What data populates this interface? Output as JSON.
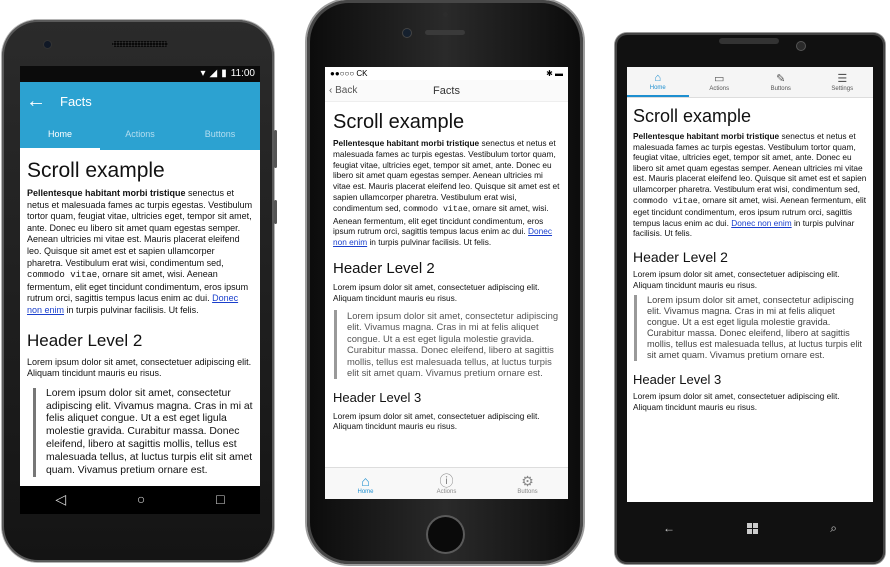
{
  "content": {
    "title": "Scroll example",
    "para_bold": "Pellentesque habitant morbi tristique",
    "para_part1": " senectus et netus et malesuada fames ac turpis egestas. Vestibulum tortor quam, feugiat vitae, ultricies eget, tempor sit amet, ante. Donec eu libero sit amet quam egestas semper. Aenean ultricies mi vitae est. Mauris placerat eleifend leo. Quisque sit amet est et sapien ullamcorper pharetra. Vestibulum erat wisi, condimentum sed, ",
    "para_code": "commodo vitae",
    "para_part2": ", ornare sit amet, wisi. Aenean fermentum, elit eget tincidunt condimentum, eros ipsum rutrum orci, sagittis tempus lacus enim ac dui. ",
    "para_link": "Donec non enim",
    "para_part3": " in turpis pulvinar facilisis. Ut felis.",
    "h2": "Header Level 2",
    "para2": "Lorem ipsum dolor sit amet, consectetuer adipiscing elit. Aliquam tincidunt mauris eu risus.",
    "quote": "Lorem ipsum dolor sit amet, consectetur adipiscing elit. Vivamus magna. Cras in mi at felis aliquet congue. Ut a est eget ligula molestie gravida. Curabitur massa. Donec eleifend, libero at sagittis mollis, tellus est malesuada tellus, at luctus turpis elit sit amet quam. Vivamus pretium ornare est.",
    "h3": "Header Level 3",
    "para3": "Lorem ipsum dolor sit amet, consectetuer adipiscing elit. Aliquam tincidunt mauris eu risus."
  },
  "android": {
    "status_time": "11:00",
    "toolbar_title": "Facts",
    "back_icon": "back-arrow-icon",
    "tabs": [
      "Home",
      "Actions",
      "Buttons"
    ],
    "accent": "#2ca2d1"
  },
  "ios": {
    "carrier": "●●○○○ CK",
    "back_label": "Back",
    "nav_title": "Facts",
    "tabs": [
      "Home",
      "Actions",
      "Buttons"
    ],
    "accent": "#1e8fd0"
  },
  "windows": {
    "tabs": [
      "Home",
      "Actions",
      "Buttons",
      "Settings"
    ],
    "accent": "#1e8fd0"
  }
}
